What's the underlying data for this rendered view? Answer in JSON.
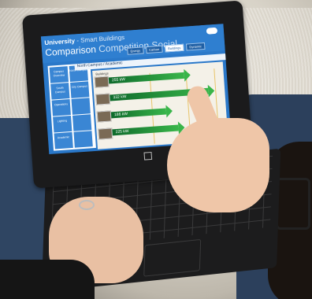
{
  "app": {
    "title_brand": "University",
    "title_sub": "- Smart Buildings",
    "title_main": "Comparison",
    "title_dim": "Competition Social"
  },
  "filters": [
    {
      "label": "Energy",
      "active": false
    },
    {
      "label": "Carbon",
      "active": false
    },
    {
      "label": "Buildings",
      "active": true
    },
    {
      "label": "Dynamic",
      "active": false
    }
  ],
  "breadcrumb": "North Campus / Academic",
  "left_tiles": [
    {
      "label": "Campus Overview"
    },
    {
      "label": "North Campus"
    },
    {
      "label": "South Campus"
    },
    {
      "label": "City Campus"
    },
    {
      "label": "Operations"
    },
    {
      "label": ""
    },
    {
      "label": "Lighting"
    },
    {
      "label": ""
    },
    {
      "label": "Academic"
    },
    {
      "label": ""
    }
  ],
  "chart_data": {
    "type": "bar",
    "categories": [
      "",
      "",
      "",
      ""
    ],
    "values": [
      255,
      332,
      186,
      225
    ],
    "unit": "kW",
    "labels": [
      "255 kW",
      "332 kW",
      "186 kW",
      "225 kW"
    ],
    "header_label": "Buildings"
  }
}
